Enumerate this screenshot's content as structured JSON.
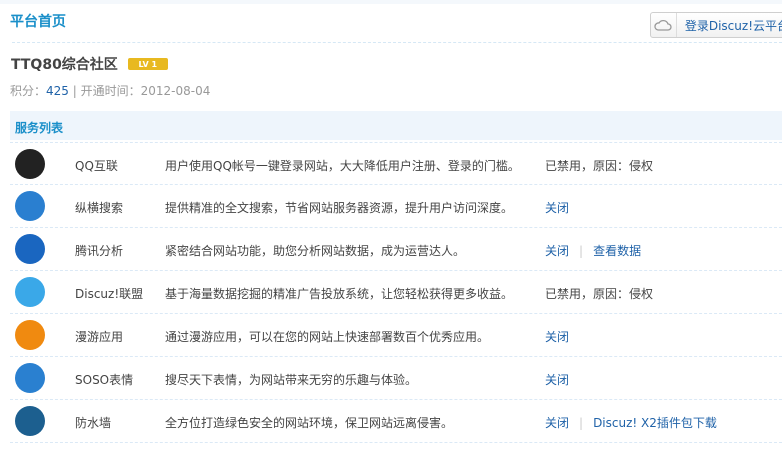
{
  "header": {
    "title": "平台首页",
    "cloud_login": "登录Discuz!云平台"
  },
  "site": {
    "name": "TTQ80综合社区",
    "level": "LV 1",
    "points_label": "积分：",
    "points": "425",
    "open_label": "开通时间：",
    "open_date": "2012-08-04"
  },
  "services": {
    "heading": "服务列表",
    "items": [
      {
        "name": "QQ互联",
        "desc": "用户使用QQ帐号一键登录网站，大大降低用户注册、登录的门槛。",
        "status": "已禁用，原因：侵权",
        "icon": "qq-penguin-icon",
        "color": "#222"
      },
      {
        "name": "纵横搜索",
        "desc": "提供精准的全文搜索，节省网站服务器资源，提升用户访问深度。",
        "action": "关闭",
        "icon": "search-s-icon",
        "color": "#2a7fd0"
      },
      {
        "name": "腾讯分析",
        "desc": "紧密结合网站功能，助您分析网站数据，成为运营达人。",
        "action": "关闭",
        "extra": "查看数据",
        "icon": "analytics-icon",
        "color": "#1a66c0"
      },
      {
        "name": "Discuz!联盟",
        "desc": "基于海量数据挖掘的精准广告投放系统，让您轻松获得更多收益。",
        "status": "已禁用，原因：侵权",
        "icon": "ad-icon",
        "color": "#3aa8e8"
      },
      {
        "name": "漫游应用",
        "desc": "通过漫游应用，可以在您的网站上快速部署数百个优秀应用。",
        "action": "关闭",
        "icon": "manyou-icon",
        "color": "#f08a10"
      },
      {
        "name": "SOSO表情",
        "desc": "搜尽天下表情，为网站带来无穷的乐趣与体验。",
        "action": "关闭",
        "icon": "soso-smiley-icon",
        "color": "#2a80d0"
      },
      {
        "name": "防水墙",
        "desc": "全方位打造绿色安全的网站环境，保卫网站远离侵害。",
        "action": "关闭",
        "extra": "Discuz! X2插件包下载",
        "icon": "shield-icon",
        "color": "#1c5f8f"
      }
    ]
  }
}
